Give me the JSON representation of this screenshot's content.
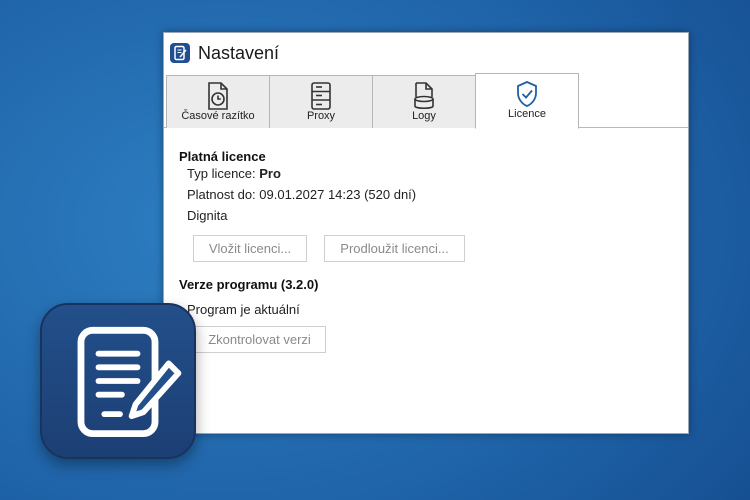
{
  "window": {
    "title": "Nastavení"
  },
  "tabs": [
    {
      "label": "Časové razítko",
      "icon": "clock-document-icon"
    },
    {
      "label": "Proxy",
      "icon": "server-icon"
    },
    {
      "label": "Logy",
      "icon": "log-document-icon"
    },
    {
      "label": "Licence",
      "icon": "shield-check-icon",
      "active": true
    }
  ],
  "license": {
    "section_title": "Platná licence",
    "type_label": "Typ licence: ",
    "type_value": "Pro",
    "validity": "Platnost do: 09.01.2027 14:23 (520 dní)",
    "holder": "Dignita",
    "insert_button": "Vložit licenci...",
    "extend_button": "Prodloužit licenci..."
  },
  "version": {
    "section_title": "Verze programu (3.2.0)",
    "status": "Program je aktuální",
    "check_button": "Zkontrolovat verzi"
  },
  "colors": {
    "background": "#1f63a8",
    "app_icon": "#1f4f92",
    "accent": "#1f5fa6"
  }
}
